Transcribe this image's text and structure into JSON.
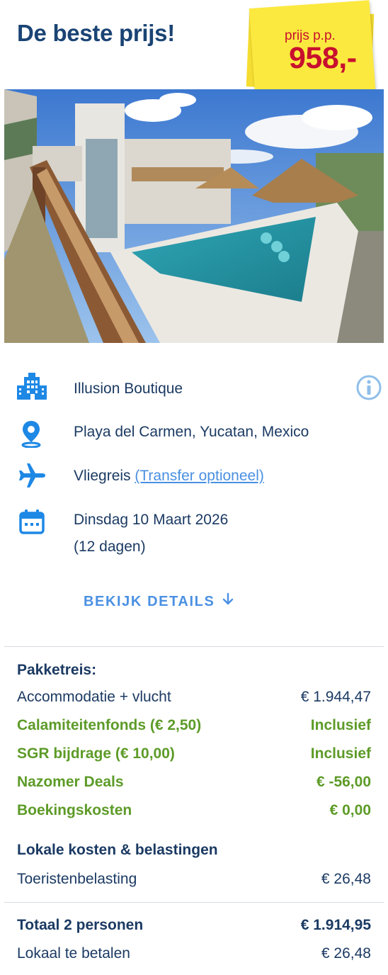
{
  "header": {
    "title": "De beste prijs!",
    "price_label": "prijs p.p.",
    "price_value": "958,-"
  },
  "hotel": {
    "name": "Illusion Boutique",
    "location": "Playa del Carmen, Yucatan, Mexico",
    "travel_type": "Vliegreis",
    "transfer_link": "(Transfer optioneel)",
    "date": "Dinsdag 10 Maart 2026",
    "duration": "(12 dagen)",
    "icons": [
      "building-icon",
      "location-pin-icon",
      "airplane-icon",
      "calendar-icon",
      "info-icon"
    ]
  },
  "details_button": "BEKIJK DETAILS",
  "price_breakdown": {
    "package_heading": "Pakketreis:",
    "lines": [
      {
        "label": "Accommodatie + vlucht",
        "value": "€ 1.944,47"
      },
      {
        "label": "Calamiteitenfonds (€ 2,50)",
        "value": "Inclusief"
      },
      {
        "label": "SGR bijdrage (€ 10,00)",
        "value": "Inclusief"
      },
      {
        "label": "Nazomer Deals",
        "value": "€ -56,00"
      },
      {
        "label": "Boekingskosten",
        "value": "€ 0,00"
      }
    ],
    "local_heading": "Lokale kosten & belastingen",
    "local_lines": [
      {
        "label": "Toeristenbelasting",
        "value": "€ 26,48"
      }
    ],
    "total": {
      "label": "Totaal 2 personen",
      "value": "€ 1.914,95"
    },
    "local_pay": {
      "label": "Lokaal te betalen",
      "value": "€ 26,48"
    }
  },
  "colors": {
    "navy": "#1a4474",
    "accent_blue": "#4a90e2",
    "green": "#5d9b28",
    "sticker_yellow": "#fbe93f",
    "price_red": "#c8102e"
  }
}
